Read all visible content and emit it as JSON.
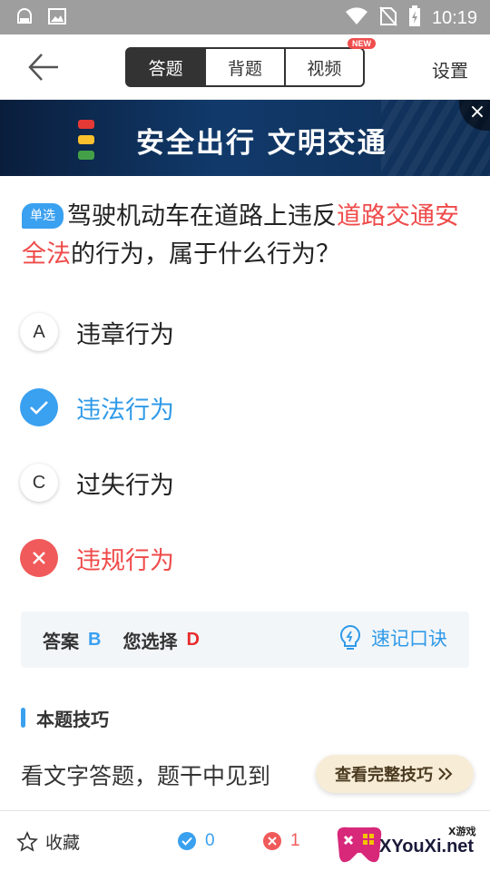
{
  "status_bar": {
    "time": "10:19"
  },
  "nav": {
    "tabs": [
      {
        "label": "答题",
        "active": true
      },
      {
        "label": "背题",
        "active": false
      },
      {
        "label": "视频",
        "active": false,
        "badge": "NEW"
      }
    ],
    "settings_label": "设置"
  },
  "banner": {
    "text": "安全出行 文明交通",
    "close": "×"
  },
  "question": {
    "type_badge": "单选",
    "text_part1": "驾驶机动车在道路上违反",
    "text_highlight": "道路交通安全法",
    "text_part2": "的行为，属于什么行为？"
  },
  "options": [
    {
      "letter": "A",
      "text": "违章行为",
      "state": "normal"
    },
    {
      "letter": "B",
      "text": "违法行为",
      "state": "correct"
    },
    {
      "letter": "C",
      "text": "过失行为",
      "state": "normal"
    },
    {
      "letter": "D",
      "text": "违规行为",
      "state": "wrong"
    }
  ],
  "answer": {
    "answer_label": "答案",
    "answer_value": "B",
    "mine_label": "您选择",
    "mine_value": "D",
    "memo_label": "速记口诀"
  },
  "tip": {
    "title": "本题技巧",
    "text": "看文字答题，题干中见到",
    "button": "查看完整技巧"
  },
  "bottom": {
    "favorite_label": "收藏",
    "correct_count": "0",
    "wrong_count": "1"
  },
  "watermark": {
    "top": "X游戏",
    "main": "XYouXi.net"
  },
  "colors": {
    "accent": "#3aa0f0",
    "error": "#f05a5a",
    "dark": "#333333"
  }
}
